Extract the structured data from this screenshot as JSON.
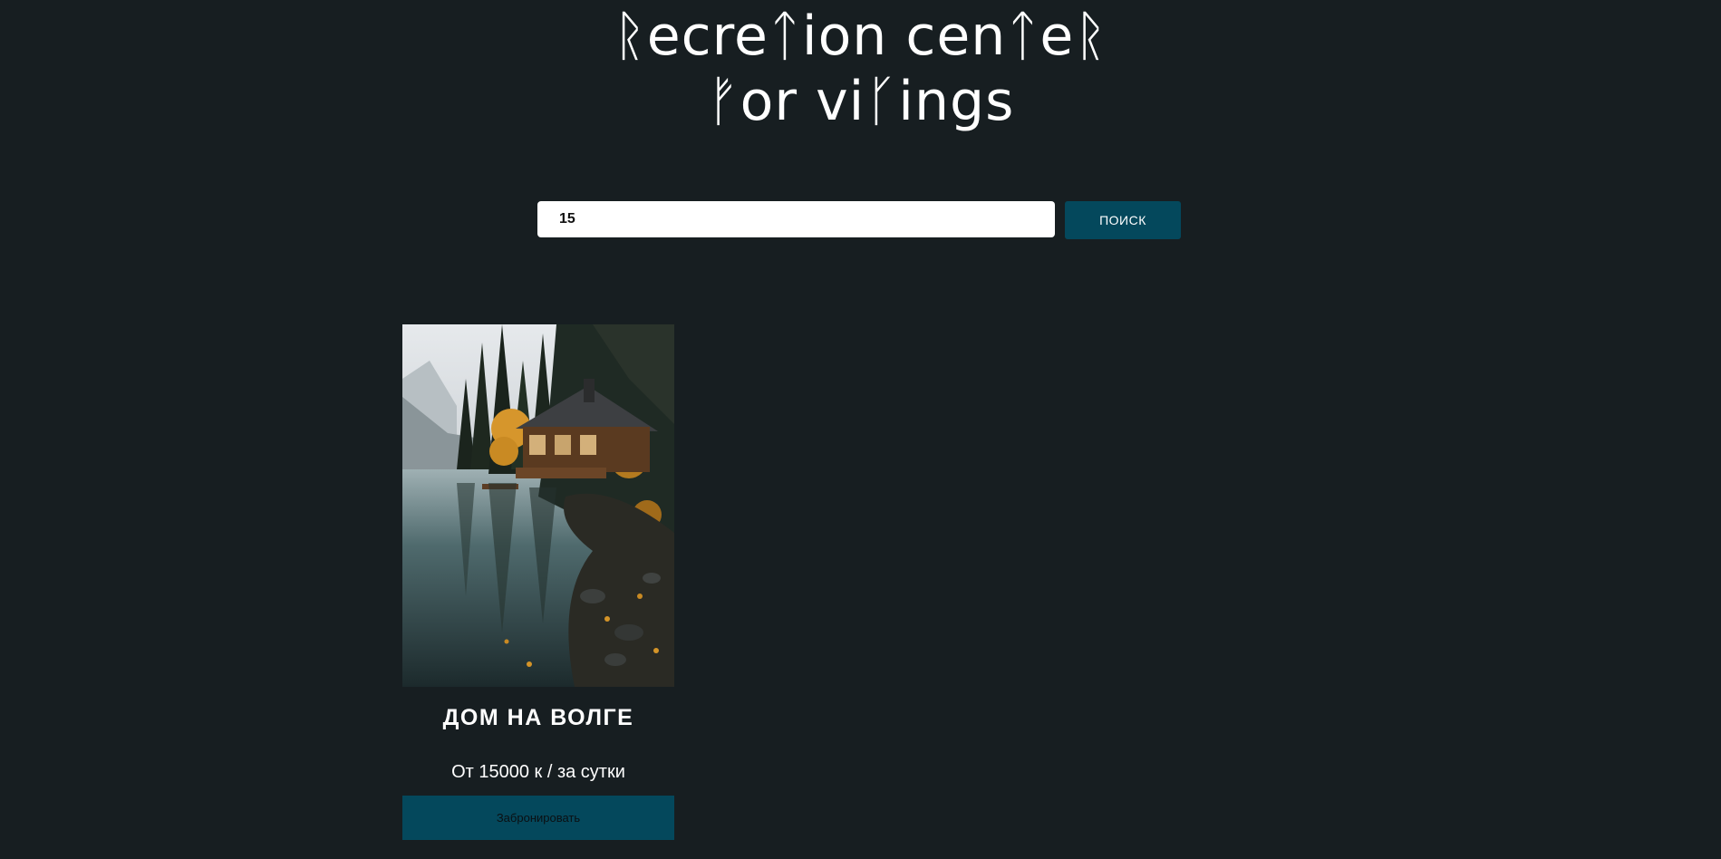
{
  "header": {
    "title_line1": "ᚱecreᛏion cenᛏeᚱ",
    "title_line2": "ᚠor viᚴings"
  },
  "search": {
    "value": "15",
    "button_label": "ПОИСК"
  },
  "cards": [
    {
      "title": "ДОМ НА ВОЛГЕ",
      "price": "От 15000 к / за сутки",
      "book_label": "Забронировать"
    }
  ],
  "colors": {
    "background": "#171e21",
    "accent": "#04485c"
  }
}
